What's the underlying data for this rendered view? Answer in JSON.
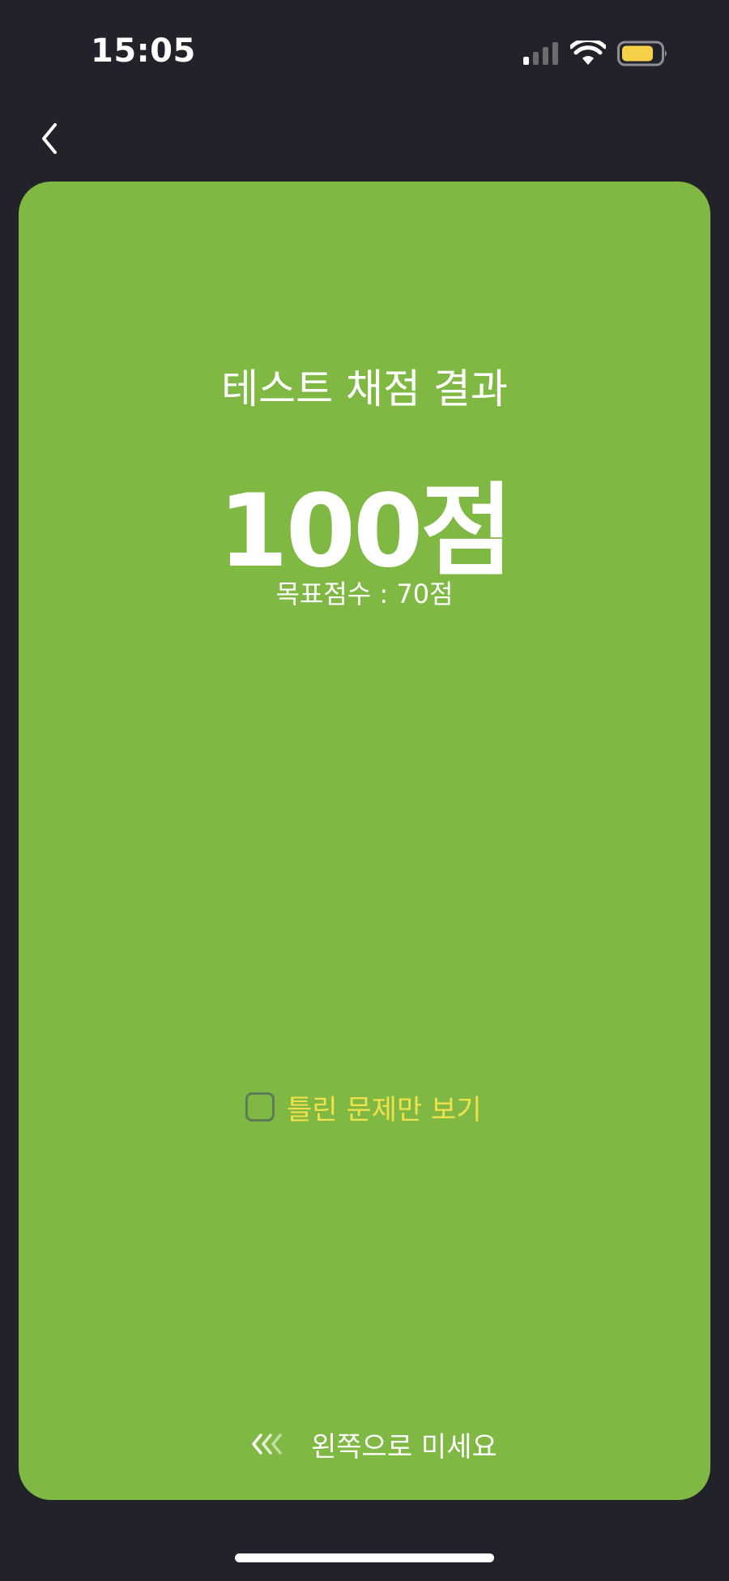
{
  "status_bar": {
    "time": "15:05",
    "signal_icon": "cellular-signal-icon",
    "wifi_icon": "wifi-icon",
    "battery_icon": "battery-icon",
    "battery_color": "#f5d14a"
  },
  "nav": {
    "back_icon": "chevron-left-icon"
  },
  "result_card": {
    "background_color": "#7fb843",
    "title": "테스트 채점 결과",
    "score": "100점",
    "target_score": "목표점수 : 70점",
    "wrong_only_checkbox": {
      "label": "틀린 문제만 보기",
      "checked": false,
      "label_color": "#f2e14a"
    },
    "swipe_hint": {
      "icon": "triple-chevron-left-icon",
      "label": "왼쪽으로 미세요"
    }
  }
}
